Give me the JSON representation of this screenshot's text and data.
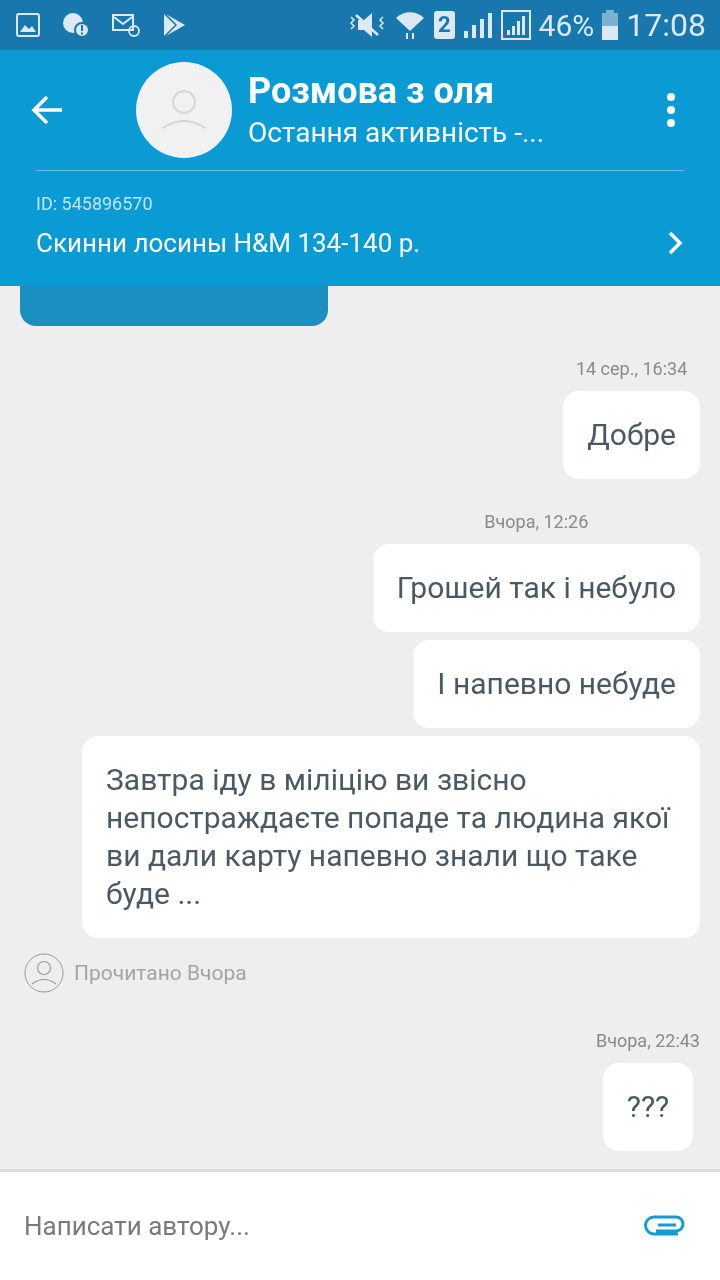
{
  "status_bar": {
    "sim": "2",
    "battery_text": "46%",
    "time": "17:08"
  },
  "header": {
    "title": "Розмова з оля",
    "subtitle": "Остання активність -...",
    "id_text": "ID: 545896570",
    "product": "Скинни лосины H&M 134-140 р."
  },
  "messages": [
    {
      "kind": "incoming",
      "cut": true
    },
    {
      "kind": "outgoing",
      "time": "14 сер., 16:34",
      "text": "Добре"
    },
    {
      "kind": "outgoing",
      "time": "Вчора, 12:26",
      "text": "Грошей так і небуло"
    },
    {
      "kind": "outgoing",
      "text": "І напевно небуде"
    },
    {
      "kind": "outgoing",
      "text": "Завтра іду в міліцію ви звісно непостраждаєте попаде та людина якої ви дали карту напевно знали що таке буде ..."
    },
    {
      "kind": "receipt",
      "text": "Прочитано Вчора"
    },
    {
      "kind": "outgoing",
      "time": "Вчора, 22:43",
      "text": "???"
    }
  ],
  "composer": {
    "placeholder": "Написати автору..."
  }
}
